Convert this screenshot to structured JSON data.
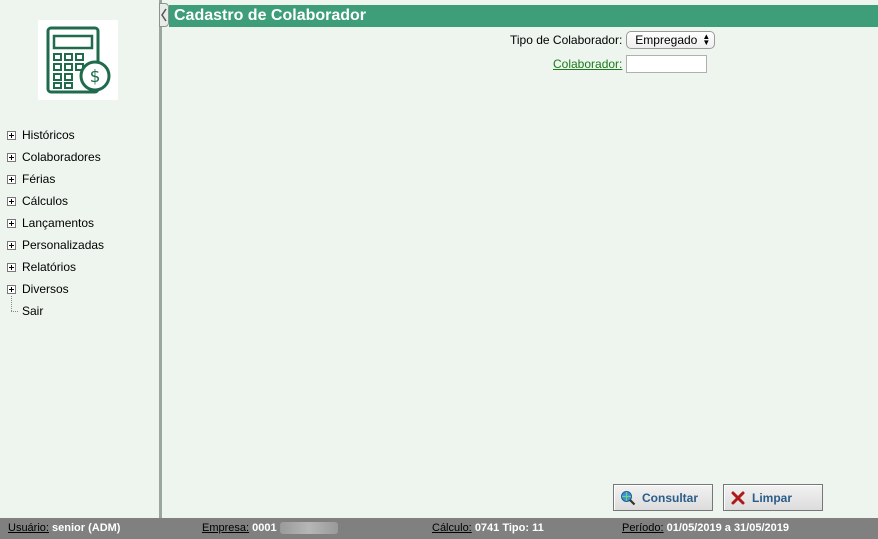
{
  "sidebar": {
    "items": [
      {
        "label": "Históricos",
        "icon": "expand-plus-icon"
      },
      {
        "label": "Colaboradores",
        "icon": "expand-plus-icon"
      },
      {
        "label": "Férias",
        "icon": "expand-plus-icon"
      },
      {
        "label": "Cálculos",
        "icon": "expand-plus-icon"
      },
      {
        "label": "Lançamentos",
        "icon": "expand-plus-icon"
      },
      {
        "label": "Personalizadas",
        "icon": "expand-plus-icon"
      },
      {
        "label": "Relatórios",
        "icon": "expand-plus-icon"
      },
      {
        "label": "Diversos",
        "icon": "expand-plus-icon"
      },
      {
        "label": "Sair",
        "icon": "tree-leaf-line"
      }
    ]
  },
  "header": {
    "title": "Cadastro de Colaborador"
  },
  "form": {
    "tipo_label": "Tipo de Colaborador:",
    "tipo_value": "Empregado",
    "colaborador_label": "Colaborador:",
    "colaborador_value": ""
  },
  "actions": {
    "consultar_label": "Consultar",
    "limpar_label": "Limpar"
  },
  "status": {
    "usuario_key": "Usuário:",
    "usuario_value": "senior (ADM)",
    "empresa_key": "Empresa:",
    "empresa_value": "0001",
    "calculo_key": "Cálculo:",
    "calculo_value": "0741 Tipo: 11",
    "periodo_key": "Período:",
    "periodo_value": "01/05/2019 a 31/05/2019"
  },
  "colors": {
    "accent": "#3f9e7a",
    "background": "#eef5ef",
    "status_bar": "#808080",
    "link": "#1a7a1a"
  }
}
